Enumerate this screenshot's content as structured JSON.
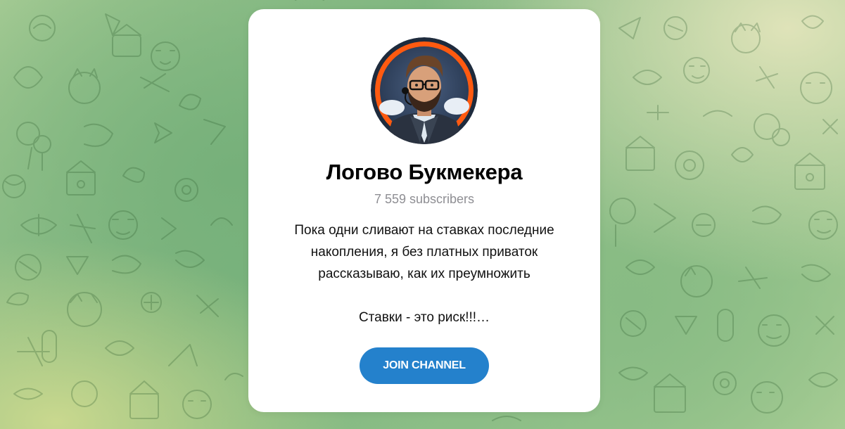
{
  "channel": {
    "name": "Логово Букмекера",
    "subscribers": "7 559 subscribers",
    "description_lines": [
      "Пока одни сливают на ставках последние",
      "накопления, я без платных приваток",
      "рассказываю, как их преумножить"
    ],
    "description_tail": "Ставки - это риск!!!…",
    "avatar_icon": "avatar-man-glasses"
  },
  "actions": {
    "join_label": "JOIN CHANNEL"
  },
  "colors": {
    "accent": "#2481cc",
    "avatar_ring": "#ff5a10",
    "background": "#7db57f"
  }
}
